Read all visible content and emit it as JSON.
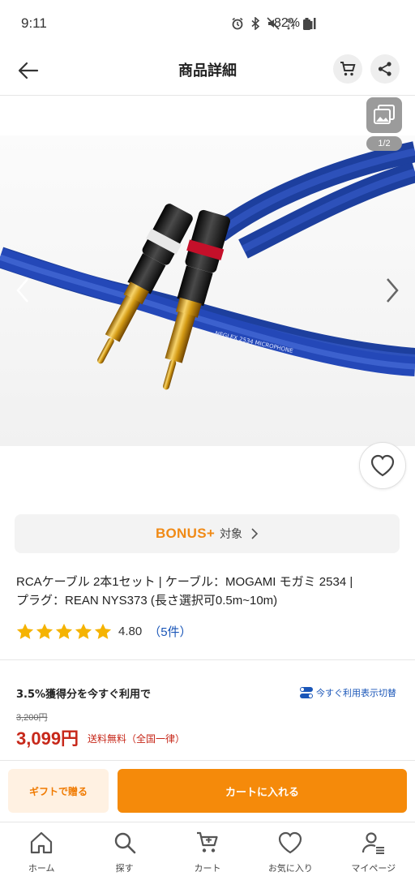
{
  "status_bar": {
    "time": "9:11",
    "battery": "82%"
  },
  "header": {
    "title": "商品詳細",
    "icons": [
      "back-arrow-icon",
      "cart-icon",
      "share-icon"
    ]
  },
  "gallery": {
    "page_counter": "1/2",
    "icons": [
      "gallery-toggle-icon",
      "chevron-left-icon",
      "chevron-right-icon",
      "heart-icon"
    ],
    "cable_print": "NEGLEX   2534   MICROPHONE",
    "colors": {
      "cable": "#2448b8",
      "plug_gold": "#d4a017",
      "white_ring": "#e8e8e8",
      "red_ring": "#c4102a"
    }
  },
  "bonus": {
    "logo": "BONUS+",
    "text": "対象",
    "color": "#f08a16"
  },
  "product": {
    "title_line1": "RCAケーブル 2本1セット | ケーブル：MOGAMI モガミ 2534 |",
    "title_line2": "プラグ：REAN NYS373 (長さ選択可0.5m~10m)",
    "rating_value": "4.80",
    "review_count": "（5件）",
    "stars": 5,
    "star_color": "#f5b301"
  },
  "points": {
    "text": "3.5%獲得分を今すぐ利用で",
    "switch_label": "今すぐ利用表示切替"
  },
  "price": {
    "original": "3,200円",
    "sale": "3,099円",
    "shipping": "送料無料（全国一律）",
    "color": "#c7281a"
  },
  "actions": {
    "gift_label": "ギフトで贈る",
    "cart_label": "カートに入れる",
    "accent": "#f58a0a"
  },
  "bottom_nav": {
    "items": [
      {
        "label": "ホーム",
        "icon": "home-icon"
      },
      {
        "label": "探す",
        "icon": "search-icon"
      },
      {
        "label": "カート",
        "icon": "cart-icon"
      },
      {
        "label": "お気に入り",
        "icon": "heart-icon"
      },
      {
        "label": "マイページ",
        "icon": "user-icon"
      }
    ]
  }
}
